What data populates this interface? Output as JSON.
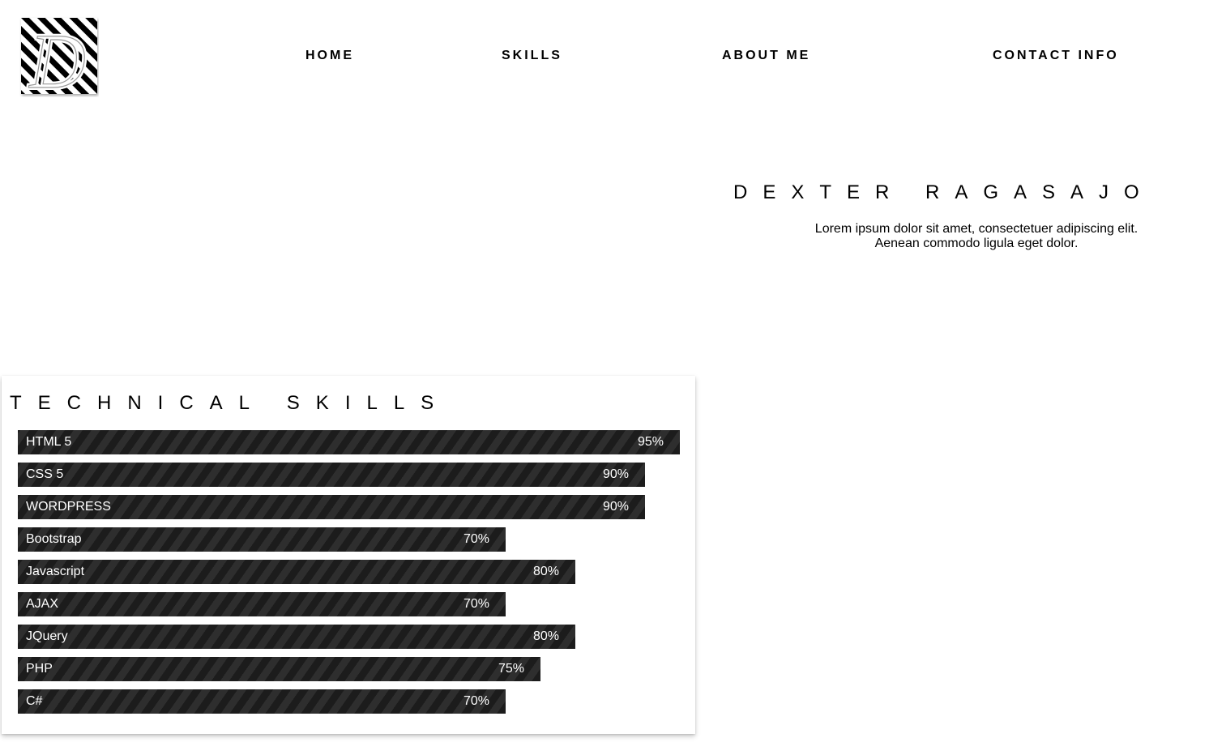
{
  "logo": {
    "letter": "D",
    "icon": "striped-d-logo-icon"
  },
  "nav": {
    "items": [
      {
        "label": "HOME"
      },
      {
        "label": "SKILLS"
      },
      {
        "label": "ABOUT ME"
      },
      {
        "label": "CONTACT INFO"
      }
    ]
  },
  "hero": {
    "name": "DEXTER RAGASAJO",
    "line1": "Lorem ipsum dolor sit amet, consectetuer adipiscing elit.",
    "line2": "Aenean commodo ligula eget dolor."
  },
  "skills": {
    "title": "TECHNICAL SKILLS",
    "bar_colors": {
      "dark": "#1c1c1c",
      "light": "#2e2e2e"
    },
    "items": [
      {
        "name": "HTML 5",
        "percent": 95,
        "label": "95%"
      },
      {
        "name": "CSS 5",
        "percent": 90,
        "label": "90%"
      },
      {
        "name": "WORDPRESS",
        "percent": 90,
        "label": "90%"
      },
      {
        "name": "Bootstrap",
        "percent": 70,
        "label": "70%"
      },
      {
        "name": "Javascript",
        "percent": 80,
        "label": "80%"
      },
      {
        "name": "AJAX",
        "percent": 70,
        "label": "70%"
      },
      {
        "name": "JQuery",
        "percent": 80,
        "label": "80%"
      },
      {
        "name": "PHP",
        "percent": 75,
        "label": "75%"
      },
      {
        "name": "C#",
        "percent": 70,
        "label": "70%"
      }
    ]
  }
}
